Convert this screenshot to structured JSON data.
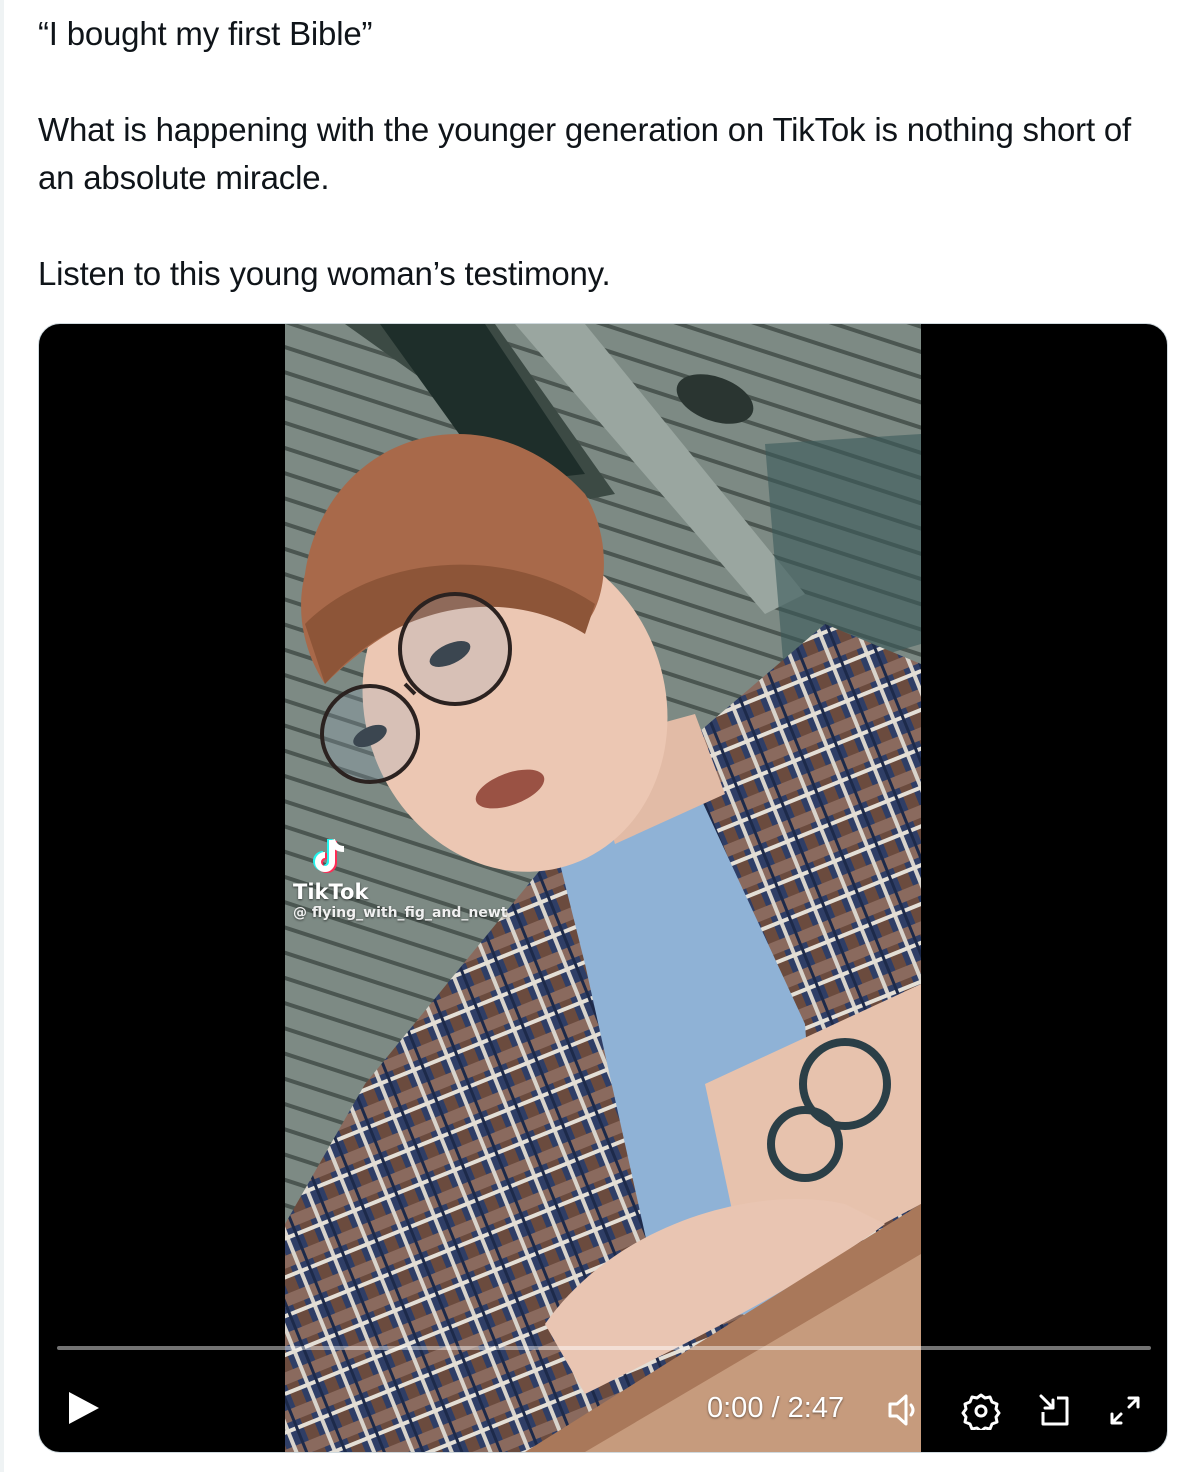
{
  "tweet": {
    "lines": [
      "“I bought my first Bible”",
      "What is happening with the younger generation on TikTok is nothing short of an absolute miracle.",
      "Listen to this young woman’s testimony."
    ]
  },
  "video": {
    "watermark": {
      "brand": "TikTok",
      "handle": "@ flying_with_fig_and_newt"
    },
    "player": {
      "current_time": "0:00",
      "separator": "/",
      "duration": "2:47",
      "progress_fraction": 0,
      "accent_color": "#1d9bf0",
      "icons": [
        "play-icon",
        "volume-icon",
        "settings-gear-icon",
        "picture-in-picture-icon",
        "fullscreen-icon"
      ]
    }
  }
}
